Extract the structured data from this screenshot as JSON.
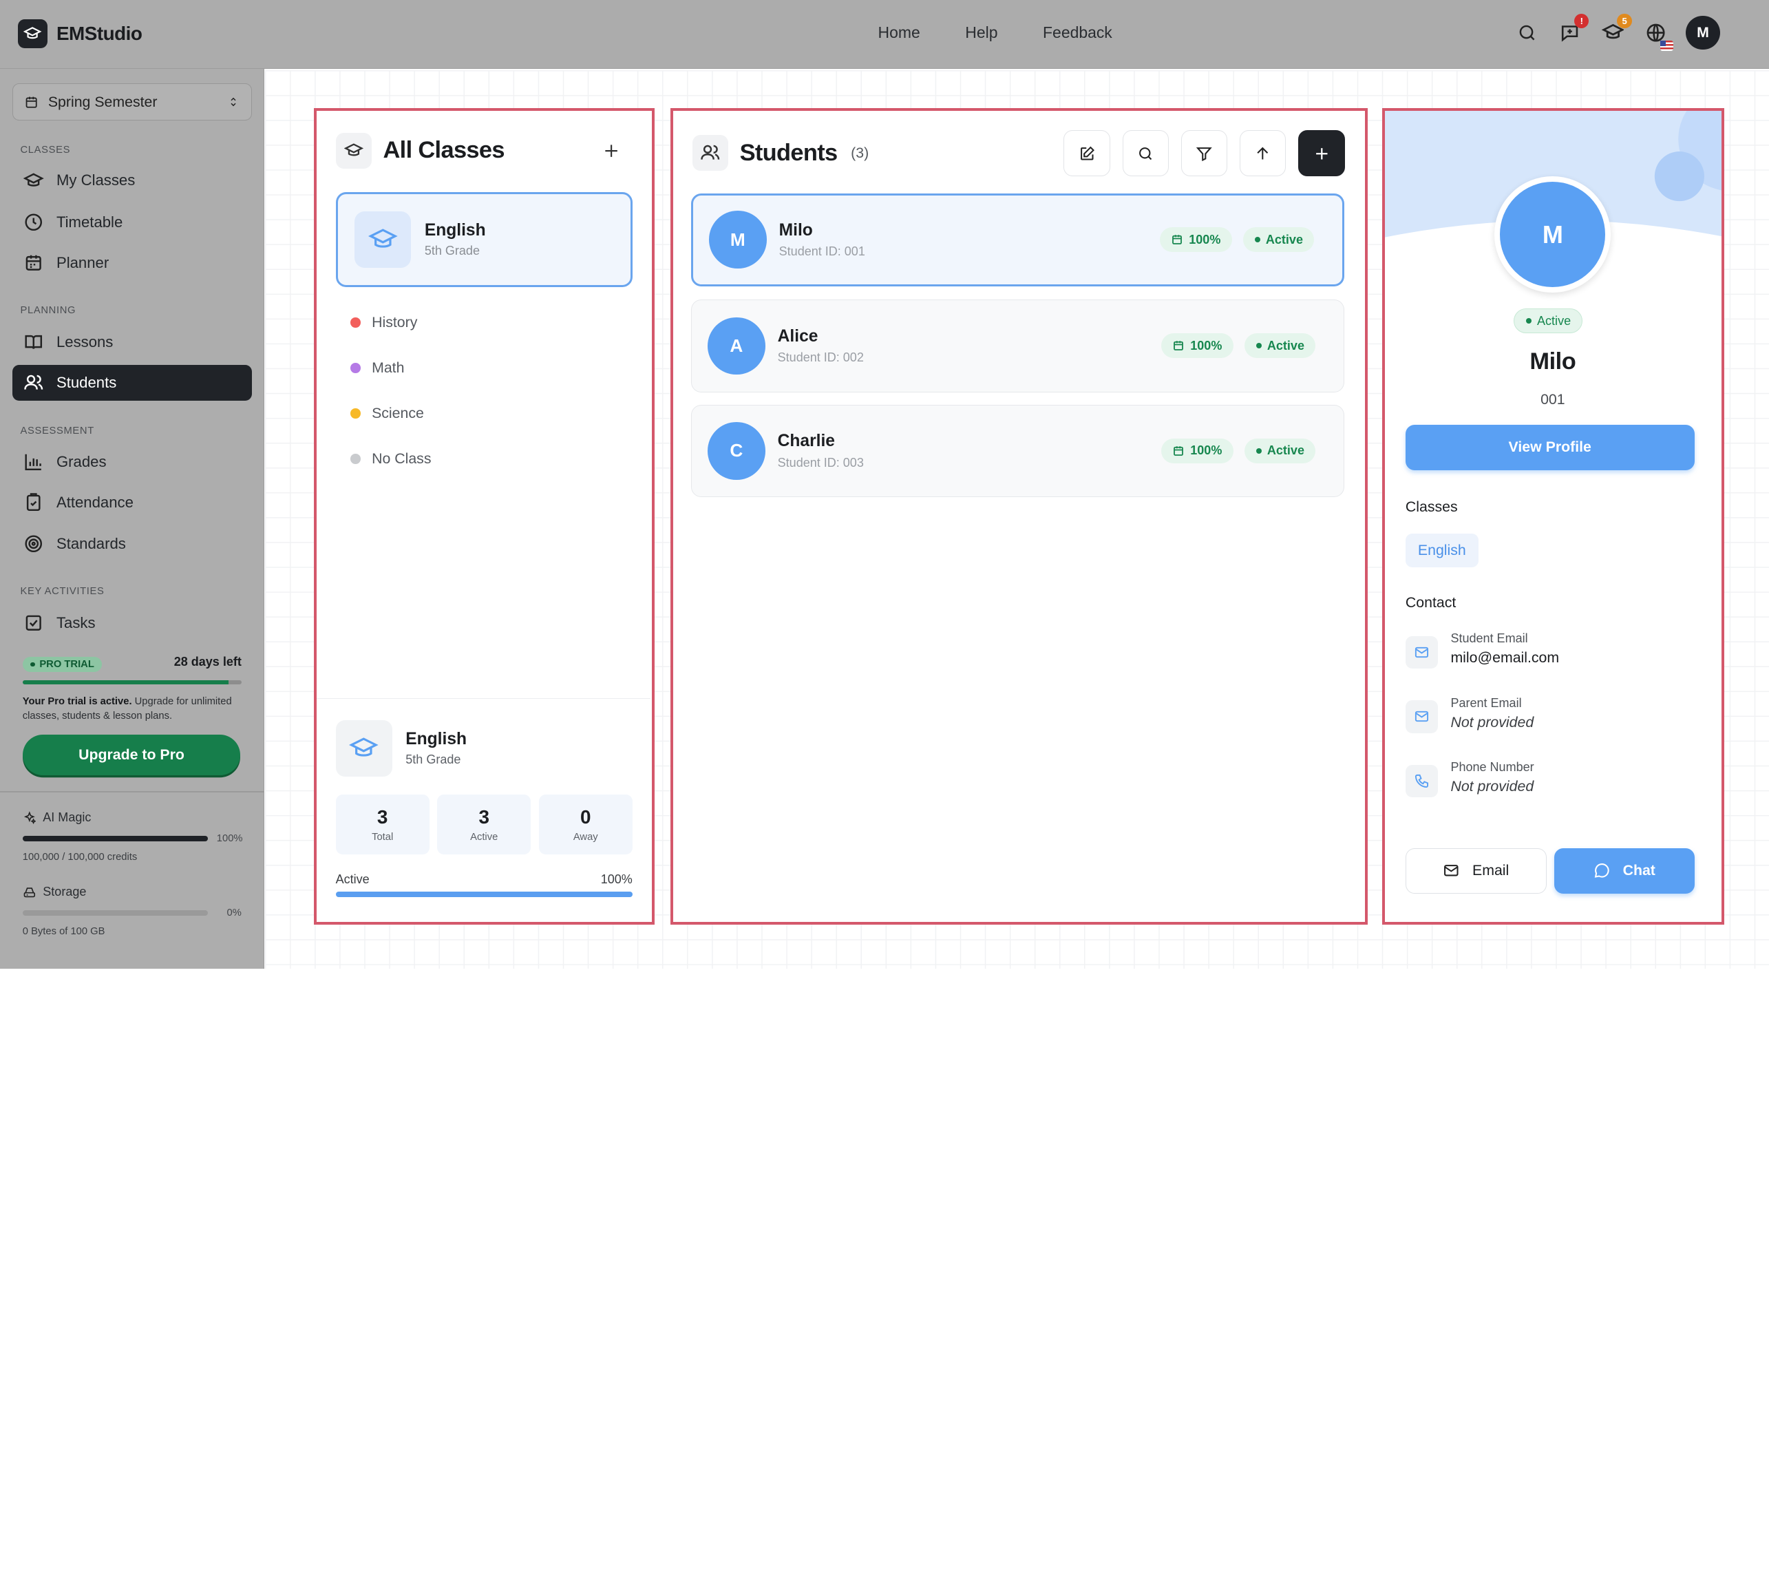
{
  "app": {
    "name": "EMStudio"
  },
  "topnav": {
    "home": "Home",
    "help": "Help",
    "feedback": "Feedback"
  },
  "topicons": {
    "notifications_badge": "!",
    "courses_badge": "5",
    "avatar_initial": "M",
    "badge_colors": {
      "notifications": "#d32f2f",
      "courses": "#e08a1e"
    }
  },
  "sidebar": {
    "semester": "Spring Semester",
    "sections": {
      "classes": "CLASSES",
      "planning": "PLANNING",
      "assessment": "ASSESSMENT",
      "key_activities": "KEY ACTIVITIES"
    },
    "items": {
      "my_classes": "My Classes",
      "timetable": "Timetable",
      "planner": "Planner",
      "lessons": "Lessons",
      "students": "Students",
      "grades": "Grades",
      "attendance": "Attendance",
      "standards": "Standards",
      "tasks": "Tasks"
    },
    "trial": {
      "pill": "PRO TRIAL",
      "days_left": "28 days left",
      "progress": 0.94,
      "text_bold": "Your Pro trial is active.",
      "text_rest": " Upgrade for unlimited classes, students & lesson plans.",
      "upgrade": "Upgrade to Pro"
    },
    "usage": {
      "ai_title": "AI Magic",
      "ai_pct": "100%",
      "ai_value": 1.0,
      "ai_credits": "100,000 / 100,000 credits",
      "storage_title": "Storage",
      "storage_pct": "0%",
      "storage_value": 0.0,
      "storage_text": "0 Bytes of 100 GB"
    }
  },
  "classes_panel": {
    "title": "All Classes",
    "selected": {
      "name": "English",
      "grade": "5th Grade"
    },
    "list": [
      {
        "name": "History",
        "color": "#f25f5c"
      },
      {
        "name": "Math",
        "color": "#b57ae6"
      },
      {
        "name": "Science",
        "color": "#f7b928"
      },
      {
        "name": "No Class",
        "color": "#c9cbce"
      }
    ],
    "footer": {
      "name": "English",
      "grade": "5th Grade",
      "stats": [
        {
          "value": "3",
          "label": "Total"
        },
        {
          "value": "3",
          "label": "Active"
        },
        {
          "value": "0",
          "label": "Away"
        }
      ],
      "active_label": "Active",
      "active_pct": "100%",
      "active_value": 1.0
    }
  },
  "students_panel": {
    "title": "Students",
    "count": "(3)",
    "students": [
      {
        "initial": "M",
        "name": "Milo",
        "id": "Student ID: 001",
        "attendance": "100%",
        "status": "Active"
      },
      {
        "initial": "A",
        "name": "Alice",
        "id": "Student ID: 002",
        "attendance": "100%",
        "status": "Active"
      },
      {
        "initial": "C",
        "name": "Charlie",
        "id": "Student ID: 003",
        "attendance": "100%",
        "status": "Active"
      }
    ]
  },
  "profile_panel": {
    "initial": "M",
    "status": "Active",
    "name": "Milo",
    "id": "001",
    "view_profile": "View Profile",
    "classes_label": "Classes",
    "class_tag": "English",
    "contact_label": "Contact",
    "student_email_label": "Student Email",
    "student_email": "milo@email.com",
    "parent_email_label": "Parent Email",
    "parent_email": "Not provided",
    "phone_label": "Phone Number",
    "phone": "Not provided",
    "email_btn": "Email",
    "chat_btn": "Chat"
  },
  "colors": {
    "accent": "#5aa0f3",
    "success": "#17874f",
    "highlight": "#d4586b",
    "dark": "#202328"
  }
}
